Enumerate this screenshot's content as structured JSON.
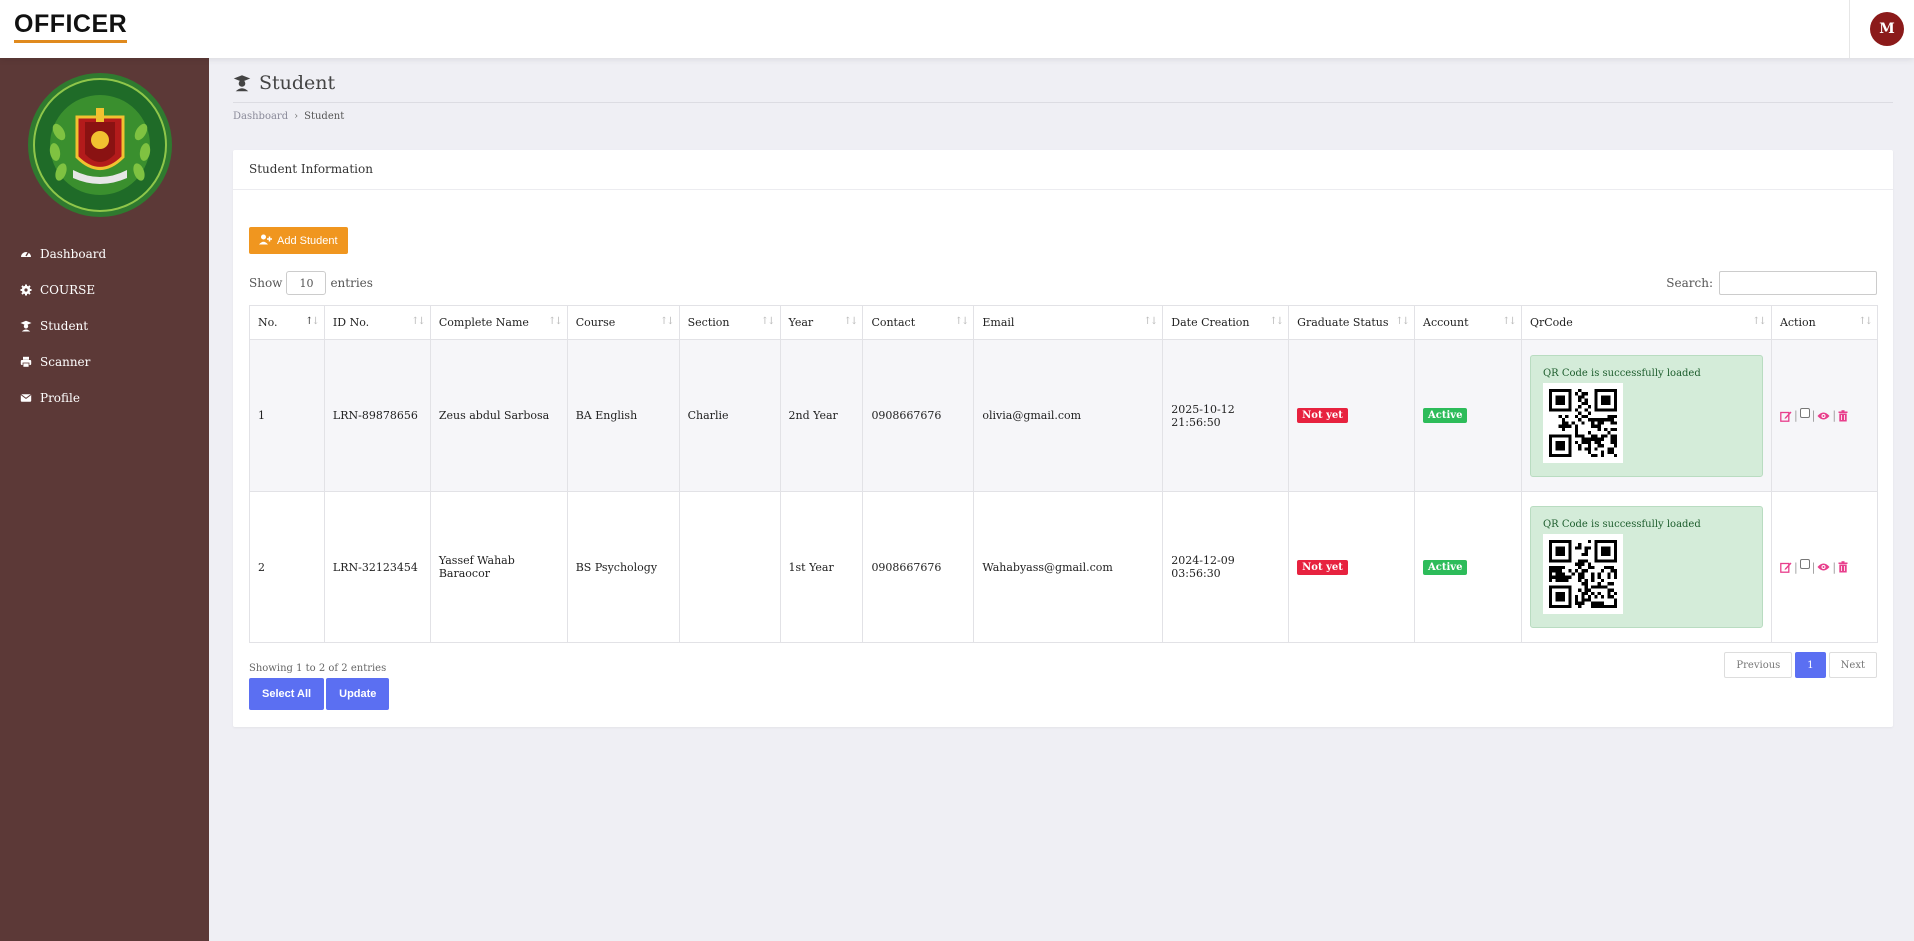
{
  "app": {
    "brand": "OFFICER",
    "avatar_initial": "M"
  },
  "sidebar": {
    "items": [
      {
        "label": "Dashboard",
        "icon": "tachometer-icon"
      },
      {
        "label": "COURSE",
        "icon": "gear-icon"
      },
      {
        "label": "Student",
        "icon": "graduate-icon"
      },
      {
        "label": "Scanner",
        "icon": "printer-icon"
      },
      {
        "label": "Profile",
        "icon": "envelope-icon"
      }
    ]
  },
  "page": {
    "title": "Student",
    "breadcrumb": [
      "Dashboard",
      "Student"
    ]
  },
  "card": {
    "title": "Student Information",
    "add_button": "Add Student"
  },
  "controls": {
    "show_label": "Show",
    "entries_value": "10",
    "entries_label": "entries",
    "search_label": "Search:",
    "search_value": ""
  },
  "table": {
    "columns": [
      "No.",
      "ID No.",
      "Complete Name",
      "Course",
      "Section",
      "Year",
      "Contact",
      "Email",
      "Date Creation",
      "Graduate Status",
      "Account",
      "QrCode",
      "Action"
    ],
    "rows": [
      {
        "no": "1",
        "id": "LRN-89878656",
        "name": "Zeus abdul Sarbosa",
        "course": "BA English",
        "section": "Charlie",
        "year": "2nd Year",
        "contact": "0908667676",
        "email": "olivia@gmail.com",
        "date": "2025-10-12 21:56:50",
        "grad_status": "Not yet",
        "account": "Active",
        "qr_msg": "QR Code is successfully loaded"
      },
      {
        "no": "2",
        "id": "LRN-32123454",
        "name": "Yassef Wahab Baraocor",
        "course": "BS Psychology",
        "section": "",
        "year": "1st Year",
        "contact": "0908667676",
        "email": "Wahabyass@gmail.com",
        "date": "2024-12-09 03:56:30",
        "grad_status": "Not yet",
        "account": "Active",
        "qr_msg": "QR Code is successfully loaded"
      }
    ]
  },
  "footer": {
    "info": "Showing 1 to 2 of 2 entries",
    "previous": "Previous",
    "page": "1",
    "next": "Next",
    "select_all": "Select All",
    "update": "Update"
  },
  "colors": {
    "sidebar": "#5c3937",
    "accent": "#f0961f",
    "primary": "#5b6ff2",
    "danger": "#e7223f",
    "success": "#2dbc5a",
    "action": "#e83e8c"
  }
}
